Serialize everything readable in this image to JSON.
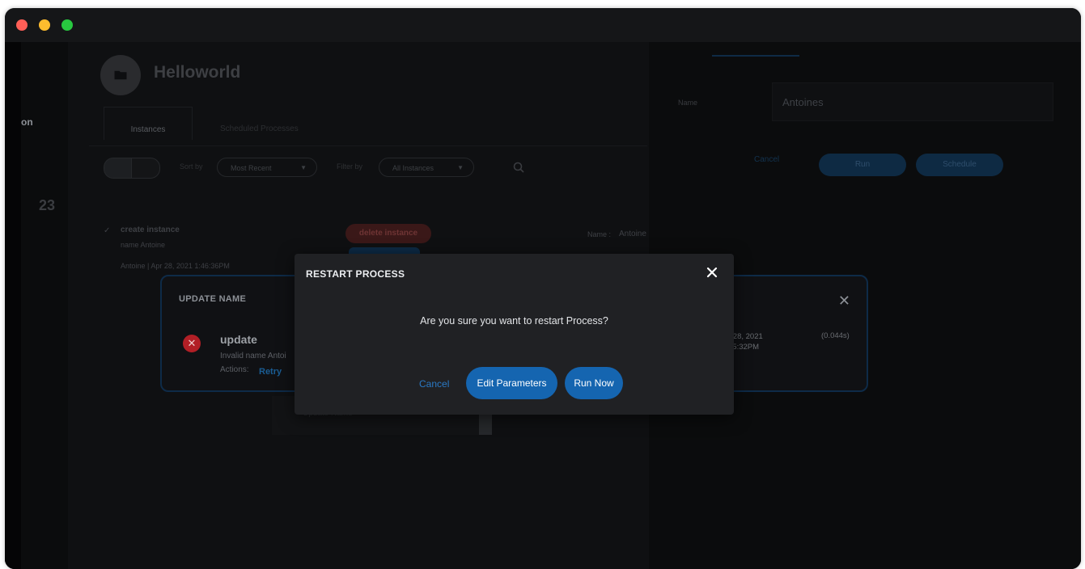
{
  "bg_page": {
    "title": "Helloworld",
    "tabs": [
      "Instances",
      "Scheduled Processes"
    ],
    "sort_label": "Sort by",
    "sort_value": "Most Recent",
    "filter_label": "Filter by",
    "filter_value": "All Instances",
    "count": "23",
    "instance_title": "create instance",
    "instance_sub": "name Antoine",
    "instance_meta": "Antoine | Apr 28, 2021 1:46:36PM",
    "delete_badge": "delete instance",
    "name_prefix": "Name :",
    "name_value": "Antoine",
    "sidebar_fragment": "on"
  },
  "right_panel": {
    "name_label": "Name",
    "name_value": "Antoines",
    "cancel_label": "Cancel",
    "run_label": "Run",
    "schedule_label": "Schedule"
  },
  "underlay_item": "Update Name",
  "update_card": {
    "title": "UPDATE NAME",
    "step_name": "update",
    "error_msg": "Invalid name Antoi",
    "actions_label": "Actions:",
    "retry_label": "Retry",
    "date_line1": "r 28, 2021",
    "date_line2": "45:32PM",
    "duration": "(0.044s)"
  },
  "modal": {
    "title": "RESTART PROCESS",
    "question": "Are you sure you want to restart Process?",
    "cancel_label": "Cancel",
    "edit_label": "Edit Parameters",
    "run_label": "Run Now"
  },
  "colors": {
    "accent": "#1565b0",
    "error": "#b21f26"
  }
}
